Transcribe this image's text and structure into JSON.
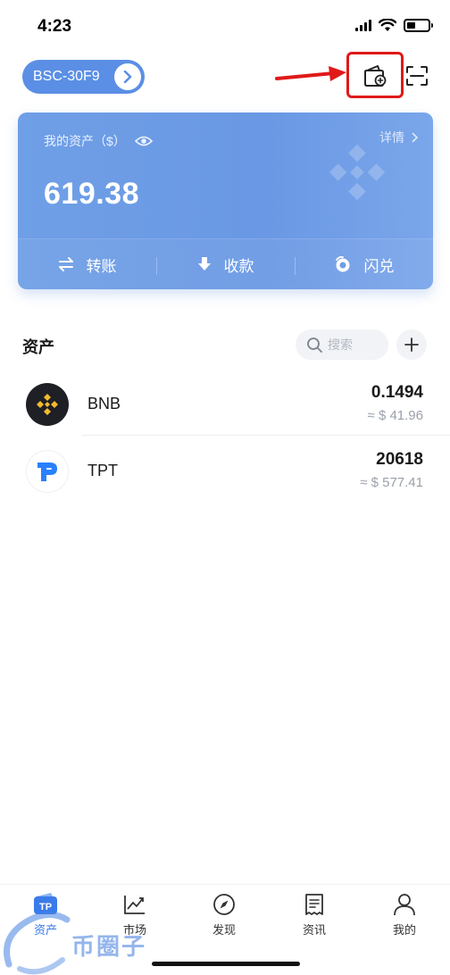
{
  "status_bar": {
    "time": "4:23"
  },
  "header": {
    "wallet_name": "BSC-30F9"
  },
  "asset_card": {
    "label": "我的资产（$）",
    "detail": "详情",
    "total": "619.38",
    "actions": [
      {
        "label": "转账",
        "icon": "swap-arrows-icon"
      },
      {
        "label": "收款",
        "icon": "download-arrow-icon"
      },
      {
        "label": "闪兑",
        "icon": "flash-swap-icon"
      }
    ]
  },
  "assets_section": {
    "title": "资产",
    "search_placeholder": "搜索"
  },
  "tokens": [
    {
      "symbol": "BNB",
      "balance": "0.1494",
      "value": "≈ $ 41.96",
      "icon": "bnb-logo-icon"
    },
    {
      "symbol": "TPT",
      "balance": "20618",
      "value": "≈ $ 577.41",
      "icon": "tpt-logo-icon"
    }
  ],
  "bottom_nav": {
    "items": [
      {
        "label": "资产",
        "icon": "tp-wallet-icon",
        "active": true
      },
      {
        "label": "市场",
        "icon": "market-chart-icon",
        "active": false
      },
      {
        "label": "发现",
        "icon": "compass-icon",
        "active": false
      },
      {
        "label": "资讯",
        "icon": "news-doc-icon",
        "active": false
      },
      {
        "label": "我的",
        "icon": "profile-icon",
        "active": false
      }
    ]
  },
  "watermark": {
    "text": "币圈子"
  },
  "colors": {
    "accent": "#3a7bea",
    "card_bg": "#6f9fe6",
    "highlight": "#e01919",
    "bnb_yellow": "#f3ba2f",
    "tpt_blue": "#2980fe"
  }
}
